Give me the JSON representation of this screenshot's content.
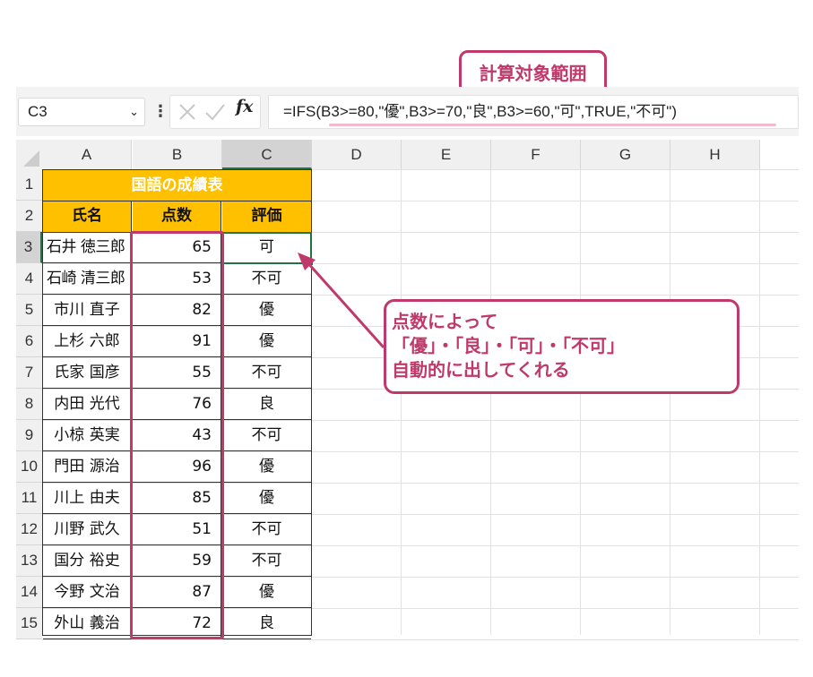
{
  "name_box": "C3",
  "formula": {
    "fx_label": "fx",
    "text": "=IFS(B3>=80,\"優\",B3>=70,\"良\",B3>=60,\"可\",TRUE,\"不可\")"
  },
  "callouts": {
    "range_label": "計算対象範囲",
    "explanation_line1": "点数によって",
    "explanation_line2": "「優」・「良」・「可」・「不可」",
    "explanation_line3": "自動的に出してくれる"
  },
  "columns": [
    "A",
    "B",
    "C",
    "D",
    "E",
    "F",
    "G",
    "H"
  ],
  "rows": [
    "1",
    "2",
    "3",
    "4",
    "5",
    "6",
    "7",
    "8",
    "9",
    "10",
    "11",
    "12",
    "13",
    "14",
    "15"
  ],
  "table": {
    "title": "国語の成績表",
    "headers": [
      "氏名",
      "点数",
      "評価"
    ],
    "records": [
      {
        "name": "石井 徳三郎",
        "score": "65",
        "grade": "可"
      },
      {
        "name": "石崎 清三郎",
        "score": "53",
        "grade": "不可"
      },
      {
        "name": "市川 直子",
        "score": "82",
        "grade": "優"
      },
      {
        "name": "上杉 六郎",
        "score": "91",
        "grade": "優"
      },
      {
        "name": "氏家 国彦",
        "score": "55",
        "grade": "不可"
      },
      {
        "name": "内田 光代",
        "score": "76",
        "grade": "良"
      },
      {
        "name": "小椋 英実",
        "score": "43",
        "grade": "不可"
      },
      {
        "name": "門田 源治",
        "score": "96",
        "grade": "優"
      },
      {
        "name": "川上 由夫",
        "score": "85",
        "grade": "優"
      },
      {
        "name": "川野 武久",
        "score": "51",
        "grade": "不可"
      },
      {
        "name": "国分 裕史",
        "score": "59",
        "grade": "不可"
      },
      {
        "name": "今野 文治",
        "score": "87",
        "grade": "優"
      },
      {
        "name": "外山 義治",
        "score": "72",
        "grade": "良"
      }
    ]
  },
  "colors": {
    "accent": "#c0396b",
    "table_header": "#ffc000",
    "selection": "#217346"
  }
}
